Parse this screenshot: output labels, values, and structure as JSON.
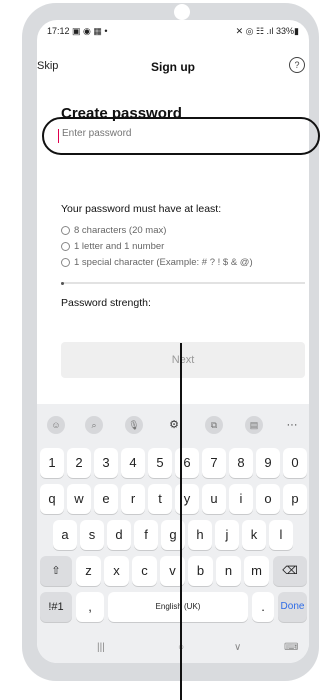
{
  "status_bar": {
    "time": "17:12 ▣ ◉ ▦ •",
    "right": "✕ ◎ ☷ .ıl 33%▮"
  },
  "header": {
    "skip": "Skip",
    "title": "Sign up",
    "help": "?"
  },
  "page": {
    "heading": "Create password",
    "password_placeholder": "Enter password",
    "rules_title": "Your password must have at least:",
    "rules": [
      "8 characters (20 max)",
      "1 letter and 1 number",
      "1 special character (Example: # ? ! $ & @)"
    ],
    "strength_label": "Password strength:",
    "next_label": "Next"
  },
  "keyboard": {
    "toolbar": [
      "☺",
      "⌕",
      "🎙",
      "⚙",
      "⧉",
      "▤",
      "···"
    ],
    "row1": [
      "1",
      "2",
      "3",
      "4",
      "5",
      "6",
      "7",
      "8",
      "9",
      "0"
    ],
    "row2": [
      "q",
      "w",
      "e",
      "r",
      "t",
      "y",
      "u",
      "i",
      "o",
      "p"
    ],
    "row3": [
      "a",
      "s",
      "d",
      "f",
      "g",
      "h",
      "j",
      "k",
      "l"
    ],
    "row4": [
      "⇧",
      "z",
      "x",
      "c",
      "v",
      "b",
      "n",
      "m",
      "⌫"
    ],
    "row5": {
      "symbols": "!#1",
      "comma": ",",
      "space": "English (UK)",
      "period": ".",
      "done": "Done"
    },
    "nav": [
      "|||",
      "○",
      "∨",
      "⌨"
    ]
  }
}
